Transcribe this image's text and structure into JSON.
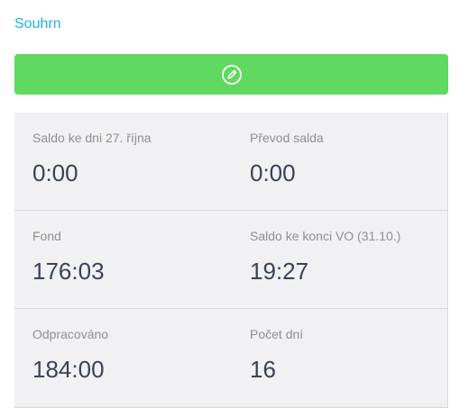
{
  "header": {
    "title": "Souhrn"
  },
  "edit_button": {
    "icon": "pencil-circle-icon",
    "color": "#5fd95f"
  },
  "summary": {
    "rows": [
      {
        "left": {
          "label": "Saldo ke dni 27. října",
          "value": "0:00"
        },
        "right": {
          "label": "Převod salda",
          "value": "0:00"
        }
      },
      {
        "left": {
          "label": "Fond",
          "value": "176:03"
        },
        "right": {
          "label": "Saldo ke konci VO (31.10.)",
          "value": "19:27"
        }
      },
      {
        "left": {
          "label": "Odpracováno",
          "value": "184:00"
        },
        "right": {
          "label": "Počet dní",
          "value": "16"
        }
      }
    ]
  },
  "colors": {
    "link": "#1fb0e8",
    "panel_bg": "#f1f1f3",
    "value_text": "#3a4257",
    "label_text": "#8f8f94"
  }
}
